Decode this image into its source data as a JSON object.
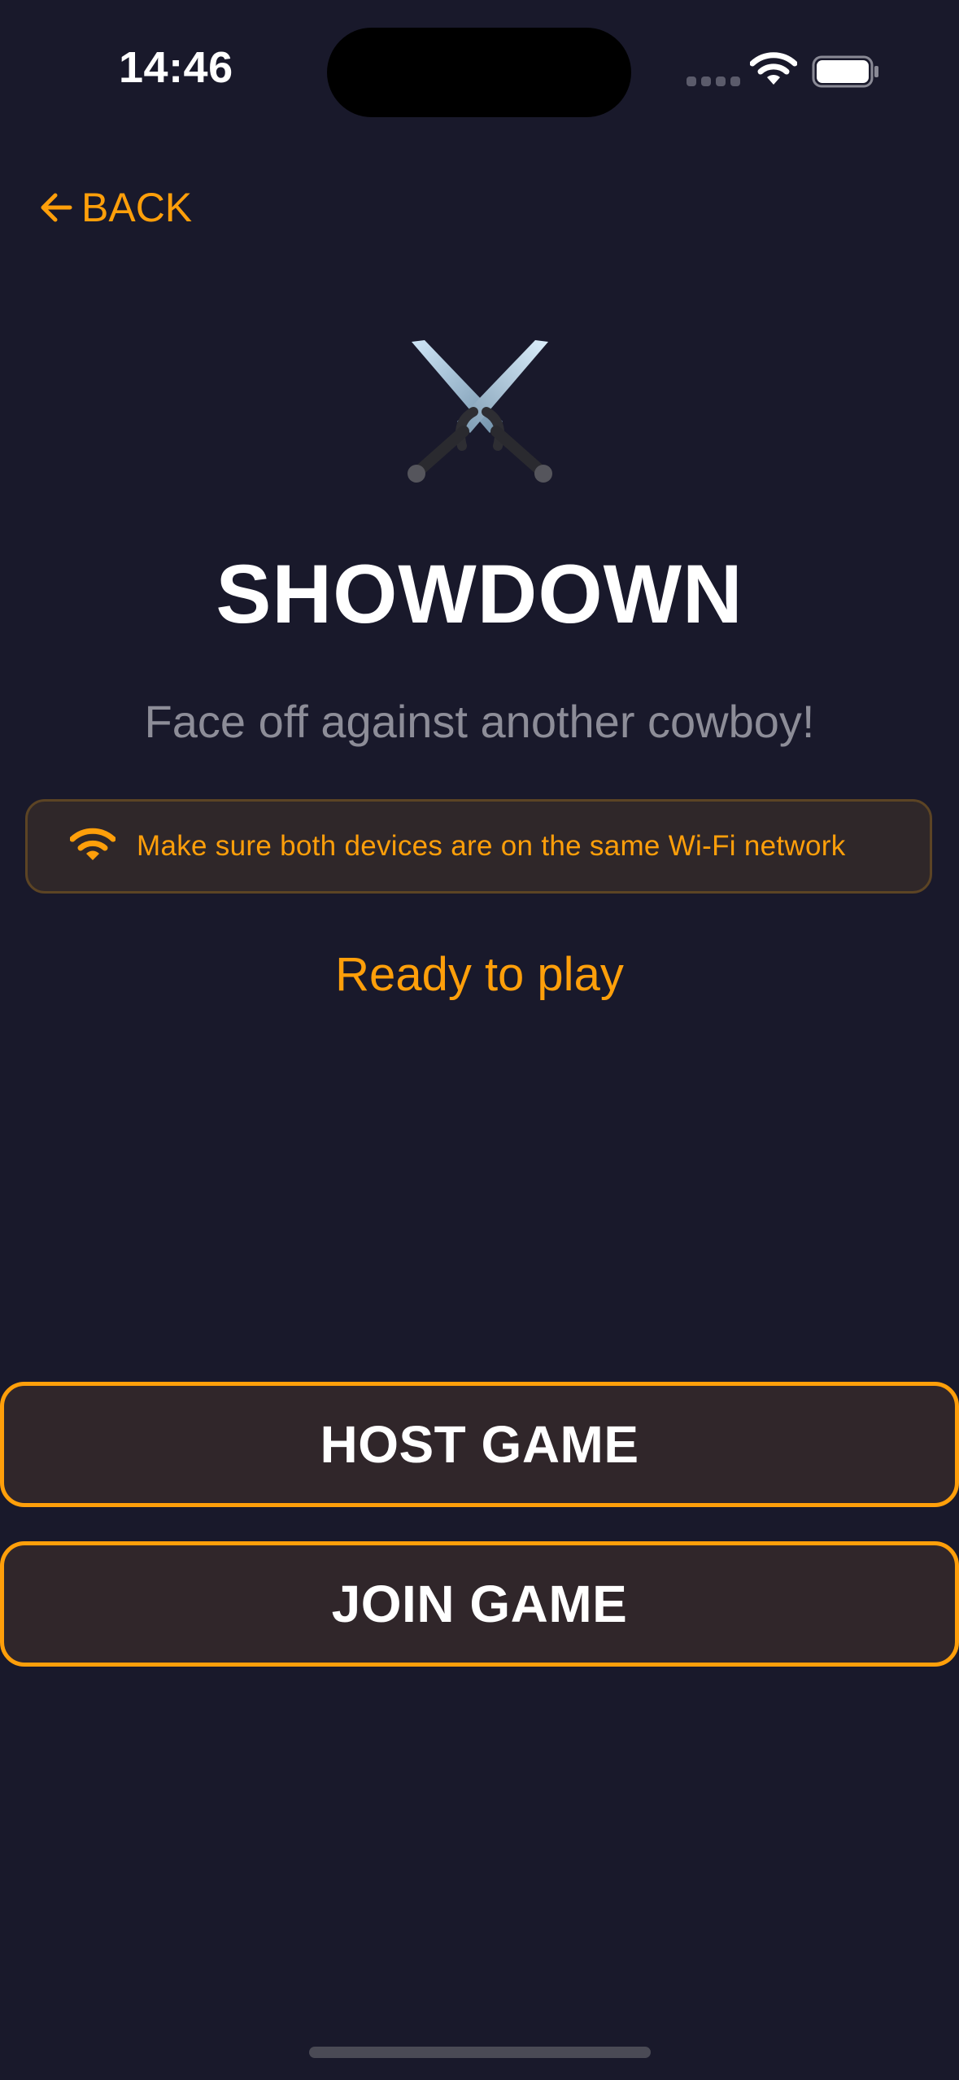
{
  "status_bar": {
    "time": "14:46"
  },
  "nav": {
    "back_label": "BACK"
  },
  "hero": {
    "icon": "crossed-swords-icon",
    "title": "SHOWDOWN",
    "subtitle": "Face off against another cowboy!"
  },
  "notice": {
    "icon": "wifi-icon",
    "text": "Make sure both devices are on the same Wi-Fi network"
  },
  "status_text": "Ready to play",
  "actions": {
    "host_label": "HOST GAME",
    "join_label": "JOIN GAME"
  },
  "colors": {
    "background": "#19192b",
    "accent": "#ff9f0a",
    "button_fill": "#30262a",
    "subtitle": "#8d8d98"
  }
}
